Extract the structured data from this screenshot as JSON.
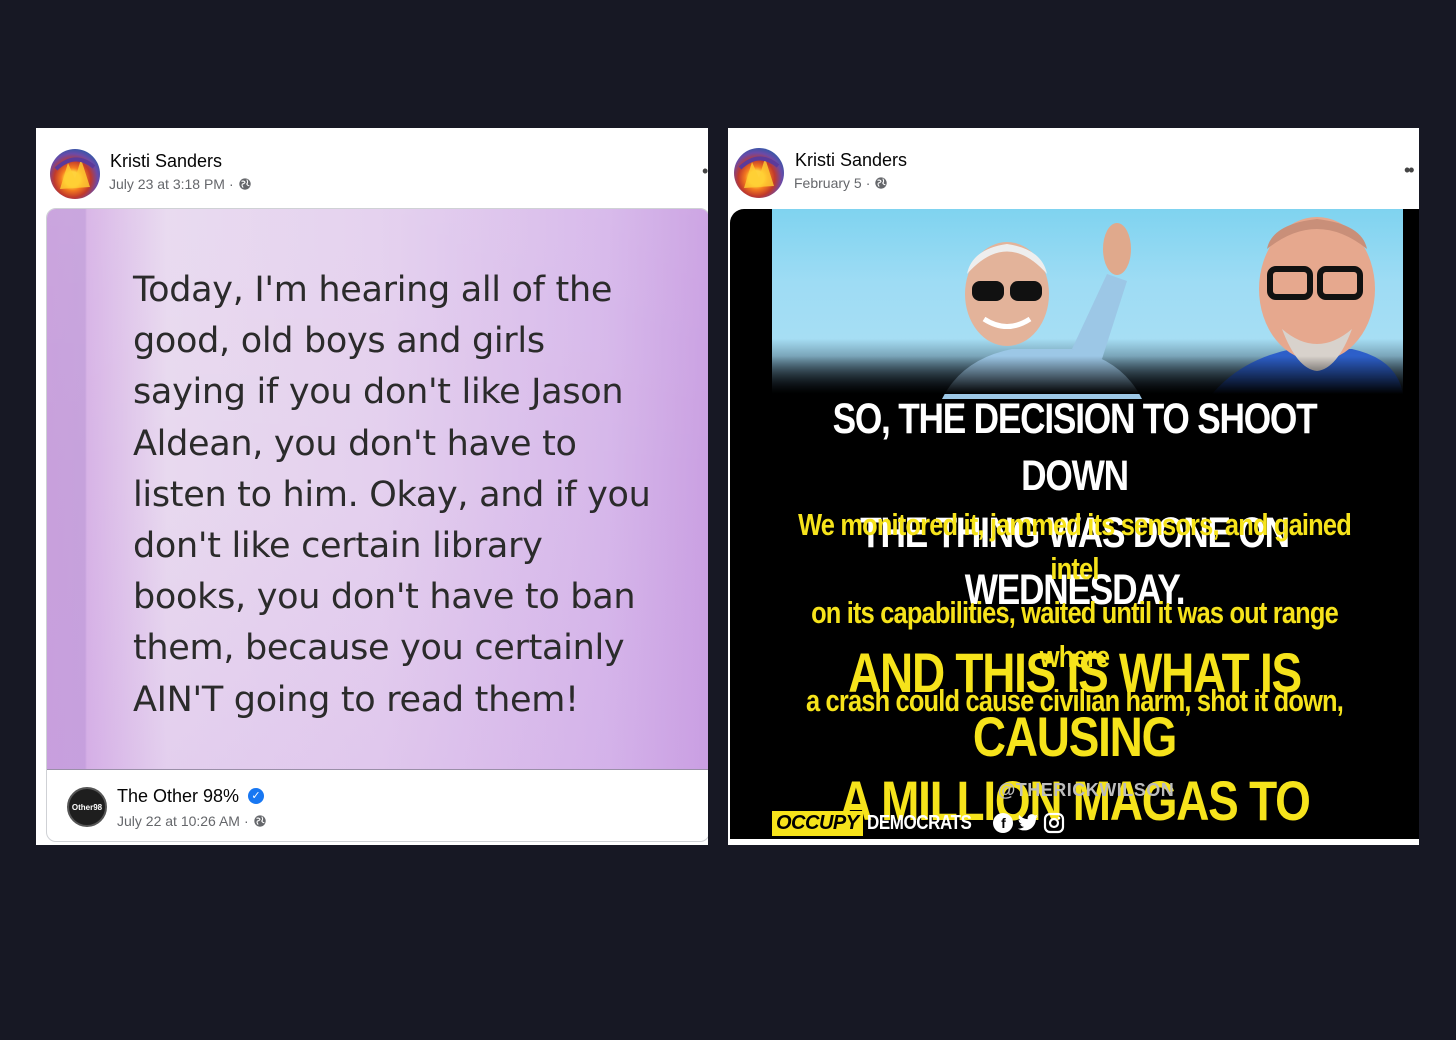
{
  "post_left": {
    "author": "Kristi Sanders",
    "timestamp": "July 23 at 3:18 PM",
    "separator": "·",
    "audience_icon": "globe-icon",
    "quote_lines": [
      "Today, I'm hearing all of the",
      "good, old boys and girls",
      "saying if you don't like Jason",
      "Aldean, you don't have to",
      "listen to him. Okay, and if you",
      "don't like certain library",
      "books, you don't have to ban",
      "them, because you certainly",
      "AIN'T going to read them!"
    ],
    "shared_source": {
      "name": "The Other 98%",
      "verified_icon": "verified-badge-icon",
      "timestamp": "July 22 at 10:26 AM",
      "separator": "·",
      "logo_text": "Other98"
    }
  },
  "post_right": {
    "author": "Kristi Sanders",
    "timestamp": "February 5",
    "separator": "·",
    "audience_icon": "globe-icon",
    "more_icon": "more-options-icon",
    "meme": {
      "headline_lines": [
        "SO, THE DECISION TO SHOOT DOWN",
        "THE THING WAS DONE ON WEDNESDAY."
      ],
      "body_lines": [
        "We monitored it, jammed its sensors, and gained intel",
        "on its capabilities, waited until it was out range where",
        "a crash could cause civilian harm, shot it down,"
      ],
      "kicker_lines": [
        "AND THIS IS WHAT IS CAUSING",
        "A MILLION MAGAS TO LOSE IT."
      ],
      "handle": "@THERICKWILSON",
      "brand_occupy": "OCCUPY",
      "brand_democrats": "DEMOCRATS",
      "social_icons": [
        "facebook-icon",
        "twitter-icon",
        "instagram-icon"
      ]
    }
  },
  "colors": {
    "background": "#171824",
    "meme_yellow": "#f6e31b",
    "verified_blue": "#1877f2"
  }
}
